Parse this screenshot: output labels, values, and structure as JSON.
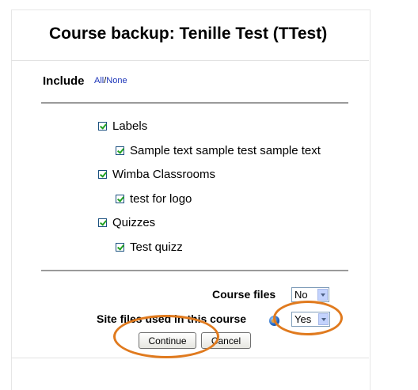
{
  "header": {
    "title": "Course backup: Tenille Test (TTest)"
  },
  "include": {
    "label": "Include",
    "all_link": "All",
    "separator": "/",
    "none_link": "None"
  },
  "modules": [
    {
      "label": "Labels",
      "checked": true,
      "children": [
        {
          "label": "Sample text sample test sample text",
          "checked": true
        }
      ]
    },
    {
      "label": "Wimba Classrooms",
      "checked": true,
      "children": [
        {
          "label": "test for logo",
          "checked": true
        }
      ]
    },
    {
      "label": "Quizzes",
      "checked": true,
      "children": [
        {
          "label": "Test quizz",
          "checked": true
        }
      ]
    }
  ],
  "options": {
    "course_files": {
      "label": "Course files",
      "value": "No"
    },
    "site_files": {
      "label": "Site files used in this course",
      "value": "Yes",
      "help_icon": "globe-help-icon"
    }
  },
  "buttons": {
    "continue": "Continue",
    "cancel": "Cancel"
  },
  "colors": {
    "link": "#1a33b8",
    "annotation": "#e07a1e",
    "checkmark": "#21a121"
  }
}
